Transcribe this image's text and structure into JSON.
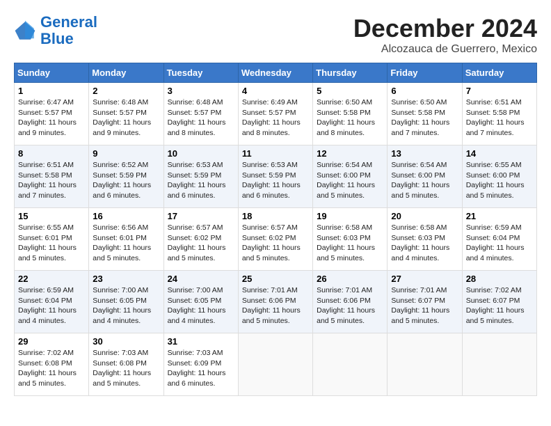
{
  "header": {
    "logo_general": "General",
    "logo_blue": "Blue",
    "month_title": "December 2024",
    "location": "Alcozauca de Guerrero, Mexico"
  },
  "days_of_week": [
    "Sunday",
    "Monday",
    "Tuesday",
    "Wednesday",
    "Thursday",
    "Friday",
    "Saturday"
  ],
  "weeks": [
    [
      {
        "day": "1",
        "sunrise": "6:47 AM",
        "sunset": "5:57 PM",
        "daylight": "11 hours and 9 minutes."
      },
      {
        "day": "2",
        "sunrise": "6:48 AM",
        "sunset": "5:57 PM",
        "daylight": "11 hours and 9 minutes."
      },
      {
        "day": "3",
        "sunrise": "6:48 AM",
        "sunset": "5:57 PM",
        "daylight": "11 hours and 8 minutes."
      },
      {
        "day": "4",
        "sunrise": "6:49 AM",
        "sunset": "5:57 PM",
        "daylight": "11 hours and 8 minutes."
      },
      {
        "day": "5",
        "sunrise": "6:50 AM",
        "sunset": "5:58 PM",
        "daylight": "11 hours and 8 minutes."
      },
      {
        "day": "6",
        "sunrise": "6:50 AM",
        "sunset": "5:58 PM",
        "daylight": "11 hours and 7 minutes."
      },
      {
        "day": "7",
        "sunrise": "6:51 AM",
        "sunset": "5:58 PM",
        "daylight": "11 hours and 7 minutes."
      }
    ],
    [
      {
        "day": "8",
        "sunrise": "6:51 AM",
        "sunset": "5:58 PM",
        "daylight": "11 hours and 7 minutes."
      },
      {
        "day": "9",
        "sunrise": "6:52 AM",
        "sunset": "5:59 PM",
        "daylight": "11 hours and 6 minutes."
      },
      {
        "day": "10",
        "sunrise": "6:53 AM",
        "sunset": "5:59 PM",
        "daylight": "11 hours and 6 minutes."
      },
      {
        "day": "11",
        "sunrise": "6:53 AM",
        "sunset": "5:59 PM",
        "daylight": "11 hours and 6 minutes."
      },
      {
        "day": "12",
        "sunrise": "6:54 AM",
        "sunset": "6:00 PM",
        "daylight": "11 hours and 5 minutes."
      },
      {
        "day": "13",
        "sunrise": "6:54 AM",
        "sunset": "6:00 PM",
        "daylight": "11 hours and 5 minutes."
      },
      {
        "day": "14",
        "sunrise": "6:55 AM",
        "sunset": "6:00 PM",
        "daylight": "11 hours and 5 minutes."
      }
    ],
    [
      {
        "day": "15",
        "sunrise": "6:55 AM",
        "sunset": "6:01 PM",
        "daylight": "11 hours and 5 minutes."
      },
      {
        "day": "16",
        "sunrise": "6:56 AM",
        "sunset": "6:01 PM",
        "daylight": "11 hours and 5 minutes."
      },
      {
        "day": "17",
        "sunrise": "6:57 AM",
        "sunset": "6:02 PM",
        "daylight": "11 hours and 5 minutes."
      },
      {
        "day": "18",
        "sunrise": "6:57 AM",
        "sunset": "6:02 PM",
        "daylight": "11 hours and 5 minutes."
      },
      {
        "day": "19",
        "sunrise": "6:58 AM",
        "sunset": "6:03 PM",
        "daylight": "11 hours and 5 minutes."
      },
      {
        "day": "20",
        "sunrise": "6:58 AM",
        "sunset": "6:03 PM",
        "daylight": "11 hours and 4 minutes."
      },
      {
        "day": "21",
        "sunrise": "6:59 AM",
        "sunset": "6:04 PM",
        "daylight": "11 hours and 4 minutes."
      }
    ],
    [
      {
        "day": "22",
        "sunrise": "6:59 AM",
        "sunset": "6:04 PM",
        "daylight": "11 hours and 4 minutes."
      },
      {
        "day": "23",
        "sunrise": "7:00 AM",
        "sunset": "6:05 PM",
        "daylight": "11 hours and 4 minutes."
      },
      {
        "day": "24",
        "sunrise": "7:00 AM",
        "sunset": "6:05 PM",
        "daylight": "11 hours and 4 minutes."
      },
      {
        "day": "25",
        "sunrise": "7:01 AM",
        "sunset": "6:06 PM",
        "daylight": "11 hours and 5 minutes."
      },
      {
        "day": "26",
        "sunrise": "7:01 AM",
        "sunset": "6:06 PM",
        "daylight": "11 hours and 5 minutes."
      },
      {
        "day": "27",
        "sunrise": "7:01 AM",
        "sunset": "6:07 PM",
        "daylight": "11 hours and 5 minutes."
      },
      {
        "day": "28",
        "sunrise": "7:02 AM",
        "sunset": "6:07 PM",
        "daylight": "11 hours and 5 minutes."
      }
    ],
    [
      {
        "day": "29",
        "sunrise": "7:02 AM",
        "sunset": "6:08 PM",
        "daylight": "11 hours and 5 minutes."
      },
      {
        "day": "30",
        "sunrise": "7:03 AM",
        "sunset": "6:08 PM",
        "daylight": "11 hours and 5 minutes."
      },
      {
        "day": "31",
        "sunrise": "7:03 AM",
        "sunset": "6:09 PM",
        "daylight": "11 hours and 6 minutes."
      },
      {
        "day": "",
        "sunrise": "",
        "sunset": "",
        "daylight": ""
      },
      {
        "day": "",
        "sunrise": "",
        "sunset": "",
        "daylight": ""
      },
      {
        "day": "",
        "sunrise": "",
        "sunset": "",
        "daylight": ""
      },
      {
        "day": "",
        "sunrise": "",
        "sunset": "",
        "daylight": ""
      }
    ]
  ]
}
